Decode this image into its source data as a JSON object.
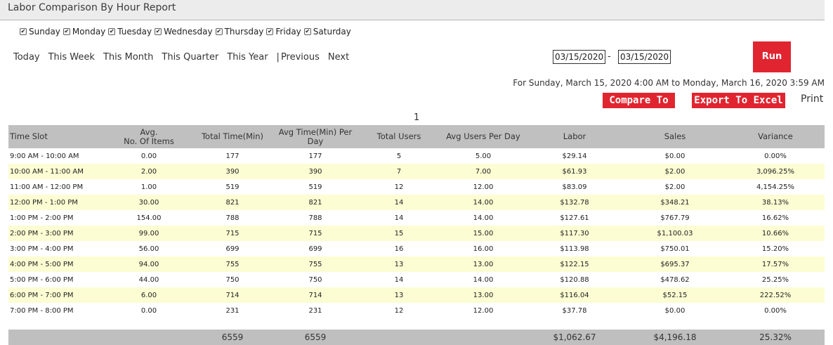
{
  "title": "Labor Comparison By Hour Report",
  "days": [
    "Sunday",
    "Monday",
    "Tuesday",
    "Wednesday",
    "Thursday",
    "Friday",
    "Saturday"
  ],
  "ranges": [
    "Today",
    "This Week",
    "This Month",
    "This Quarter",
    "This Year"
  ],
  "ranges_sep": "|",
  "previous": "Previous",
  "next": "Next",
  "date_from": "03/15/2020",
  "date_to": "03/15/2020",
  "dash": "-",
  "run_label": "Run",
  "for_text": "For Sunday, March 15, 2020 4:00 AM to Monday, March 16, 2020 3:59 AM",
  "compare_label": "Compare To",
  "export_label": "Export To Excel",
  "print_label": "Print",
  "page_number": "1",
  "colors": {
    "accent": "#e02530",
    "header": "#c0c0c0",
    "alt_row": "#fdfdd3"
  },
  "columns": {
    "time_slot": "Time Slot",
    "avg_items_1": "Avg.",
    "avg_items_2": "No. Of Items",
    "total_time": "Total Time(Min)",
    "avg_time": "Avg Time(Min) Per Day",
    "total_users": "Total Users",
    "avg_users": "Avg Users Per Day",
    "labor": "Labor",
    "sales": "Sales",
    "variance": "Variance"
  },
  "rows": [
    [
      "9:00 AM - 10:00 AM",
      "0.00",
      "177",
      "177",
      "5",
      "5.00",
      "$29.14",
      "$0.00",
      "0.00%"
    ],
    [
      "10:00 AM - 11:00 AM",
      "2.00",
      "390",
      "390",
      "7",
      "7.00",
      "$61.93",
      "$2.00",
      "3,096.25%"
    ],
    [
      "11:00 AM - 12:00 PM",
      "1.00",
      "519",
      "519",
      "12",
      "12.00",
      "$83.09",
      "$2.00",
      "4,154.25%"
    ],
    [
      "12:00 PM - 1:00 PM",
      "30.00",
      "821",
      "821",
      "14",
      "14.00",
      "$132.78",
      "$348.21",
      "38.13%"
    ],
    [
      "1:00 PM - 2:00 PM",
      "154.00",
      "788",
      "788",
      "14",
      "14.00",
      "$127.61",
      "$767.79",
      "16.62%"
    ],
    [
      "2:00 PM - 3:00 PM",
      "99.00",
      "715",
      "715",
      "15",
      "15.00",
      "$117.30",
      "$1,100.03",
      "10.66%"
    ],
    [
      "3:00 PM - 4:00 PM",
      "56.00",
      "699",
      "699",
      "16",
      "16.00",
      "$113.98",
      "$750.01",
      "15.20%"
    ],
    [
      "4:00 PM - 5:00 PM",
      "94.00",
      "755",
      "755",
      "13",
      "13.00",
      "$122.15",
      "$695.37",
      "17.57%"
    ],
    [
      "5:00 PM - 6:00 PM",
      "44.00",
      "750",
      "750",
      "14",
      "14.00",
      "$120.88",
      "$478.62",
      "25.25%"
    ],
    [
      "6:00 PM - 7:00 PM",
      "6.00",
      "714",
      "714",
      "13",
      "13.00",
      "$116.04",
      "$52.15",
      "222.52%"
    ],
    [
      "7:00 PM - 8:00 PM",
      "0.00",
      "231",
      "231",
      "12",
      "12.00",
      "$37.78",
      "$0.00",
      "0.00%"
    ]
  ],
  "totals": [
    "",
    "",
    "6559",
    "6559",
    "",
    "",
    "$1,062.67",
    "$4,196.18",
    "25.32%"
  ]
}
